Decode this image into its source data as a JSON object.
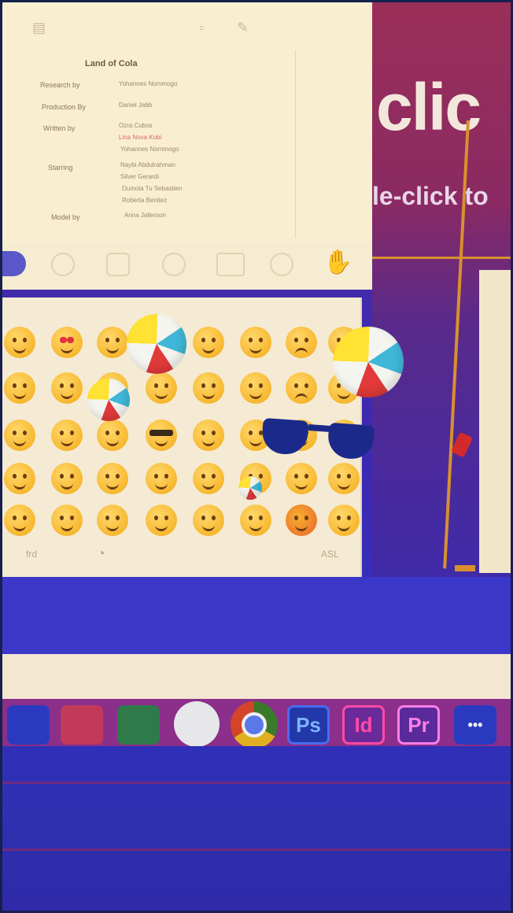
{
  "slide": {
    "word": "clic",
    "hint": "le-click to"
  },
  "document": {
    "title": "Land of Cola",
    "rows": [
      {
        "label": "Research by",
        "values": [
          "Yohannes Nommogo"
        ]
      },
      {
        "label": "Production By",
        "values": [
          "Daniel Jabb"
        ]
      },
      {
        "label": "Written by",
        "values": [
          "Ozra Cubos",
          "Lina Nova Kobi",
          "Yohannes Nommogo"
        ]
      },
      {
        "label": "Starring",
        "values": [
          "Naybi Abdulrahman",
          "Silver Gerardi",
          "Dumola Tu Sebastien",
          "Roberta Benitez"
        ]
      },
      {
        "label": "Model by",
        "values": [
          "Anna Jallerson"
        ]
      }
    ]
  },
  "emoji_panel": {
    "footer_left": "frd",
    "footer_right": "ASL"
  },
  "dock": {
    "apps": [
      {
        "name": "finder",
        "label": ""
      },
      {
        "name": "photo-booth",
        "label": ""
      },
      {
        "name": "messages",
        "label": ""
      },
      {
        "name": "safari",
        "label": ""
      },
      {
        "name": "chrome",
        "label": ""
      },
      {
        "name": "photoshop",
        "label": "Ps"
      },
      {
        "name": "indesign",
        "label": "Id"
      },
      {
        "name": "premiere",
        "label": "Pr"
      },
      {
        "name": "app-last",
        "label": "•••"
      }
    ]
  },
  "colors": {
    "slide_top": "#9a2f58",
    "screen_purple": "#3b38c9",
    "dock": "#8b2f8a",
    "cream": "#f9efd0"
  }
}
